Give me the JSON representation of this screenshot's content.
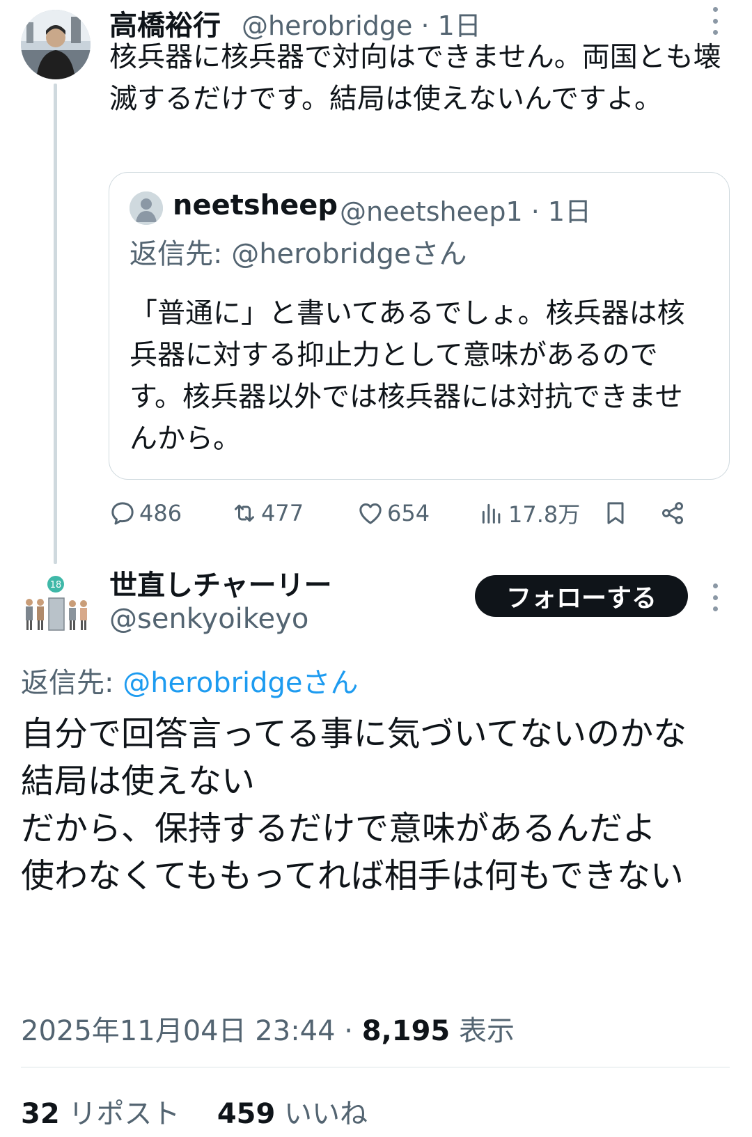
{
  "colors": {
    "text": "#0f1419",
    "secondary": "#536471",
    "link": "#1d9bf0",
    "border": "#cfd9de",
    "button_bg": "#0f1419",
    "button_text": "#ffffff"
  },
  "tweet1": {
    "name": "高橋裕行",
    "handle_time": "@herobridge · 1日",
    "text": "核兵器に核兵器で対向はできません。両国とも壊滅するだけです。結局は使えないんですよ。",
    "quote": {
      "name": "neetsheep",
      "handle_time": "@neetsheep1 · 1日",
      "reply_to": "返信先: @herobridgeさん",
      "text": "「普通に」と書いてあるでしょ。核兵器は核兵器に対する抑止力として意味があるのです。核兵器以外では核兵器には対抗できませんから。"
    },
    "actions": {
      "replies": "486",
      "reposts": "477",
      "likes": "654",
      "views": "17.8万"
    }
  },
  "tweet2": {
    "name": "世直しチャーリー",
    "handle": "@senkyoikeyo",
    "follow_label": "フォローする",
    "reply_label": "返信先: ",
    "reply_target": "@herobridgeさん",
    "lines": [
      "自分で回答言ってる事に気づいてないのかな",
      "結局は使えない",
      "だから、保持するだけで意味があるんだよ",
      "使わなくてももってれば相手は何もできない"
    ],
    "timestamp": "2025年11月04日 23:44 · ",
    "views_count": "8,195",
    "views_label": " 表示",
    "repost_count": "32",
    "repost_label": " リポスト",
    "like_count": "459",
    "like_label": " いいね"
  }
}
